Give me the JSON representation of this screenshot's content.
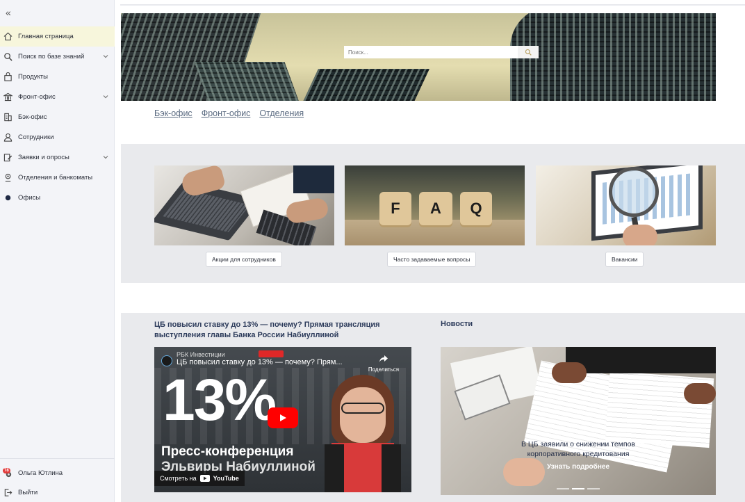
{
  "sidebar": {
    "collapse_glyph": "«",
    "items": [
      {
        "label": "Главная страница",
        "icon": "home-icon",
        "active": true
      },
      {
        "label": "Поиск по базе знаний",
        "icon": "search-icon",
        "expandable": true
      },
      {
        "label": "Продукты",
        "icon": "bag-icon"
      },
      {
        "label": "Фронт-офис",
        "icon": "bank-icon",
        "expandable": true
      },
      {
        "label": "Бэк-офис",
        "icon": "building-icon"
      },
      {
        "label": "Сотрудники",
        "icon": "user-icon"
      },
      {
        "label": "Заявки и опросы",
        "icon": "edit-icon",
        "expandable": true
      },
      {
        "label": "Отделения и банкоматы",
        "icon": "location-icon"
      },
      {
        "label": "Офисы",
        "icon": "dot-icon"
      }
    ],
    "user": {
      "name": "Ольга Ютлина",
      "badge": "78"
    },
    "logout": "Выйти"
  },
  "banner": {
    "search_placeholder": "Поиск..."
  },
  "links": [
    "Бэк-офис",
    "Фронт-офис",
    "Отделения"
  ],
  "cards": [
    {
      "button": "Акции для сотрудников",
      "image": "laptop-calculator-photo"
    },
    {
      "button": "Часто задаваемые вопросы",
      "image": "faq-cubes-photo",
      "cube_letters": [
        "F",
        "A",
        "Q"
      ]
    },
    {
      "button": "Вакансии",
      "image": "magnifier-laptop-photo"
    }
  ],
  "stream": {
    "title": "ЦБ повысил ставку до 13% — почему? Прямая трансляция выступления главы Банка России Набиуллиной",
    "video": {
      "channel": "РБК Инвестиции",
      "title": "ЦБ повысил ставку до 13% — почему? Прям...",
      "share": "Поделиться",
      "big_text": "13%",
      "caption_line1": "Пресс-конференция",
      "caption_line2": "Эльвиры Набиуллиной",
      "watch_on": "Смотреть на",
      "youtube": "YouTube"
    }
  },
  "news": {
    "heading": "Новости",
    "slide_title": "В ЦБ заявили о снижении темпов корпоративного кредитования",
    "more": "Узнать подробнее",
    "slides_total": 3,
    "slide_active": 2
  }
}
